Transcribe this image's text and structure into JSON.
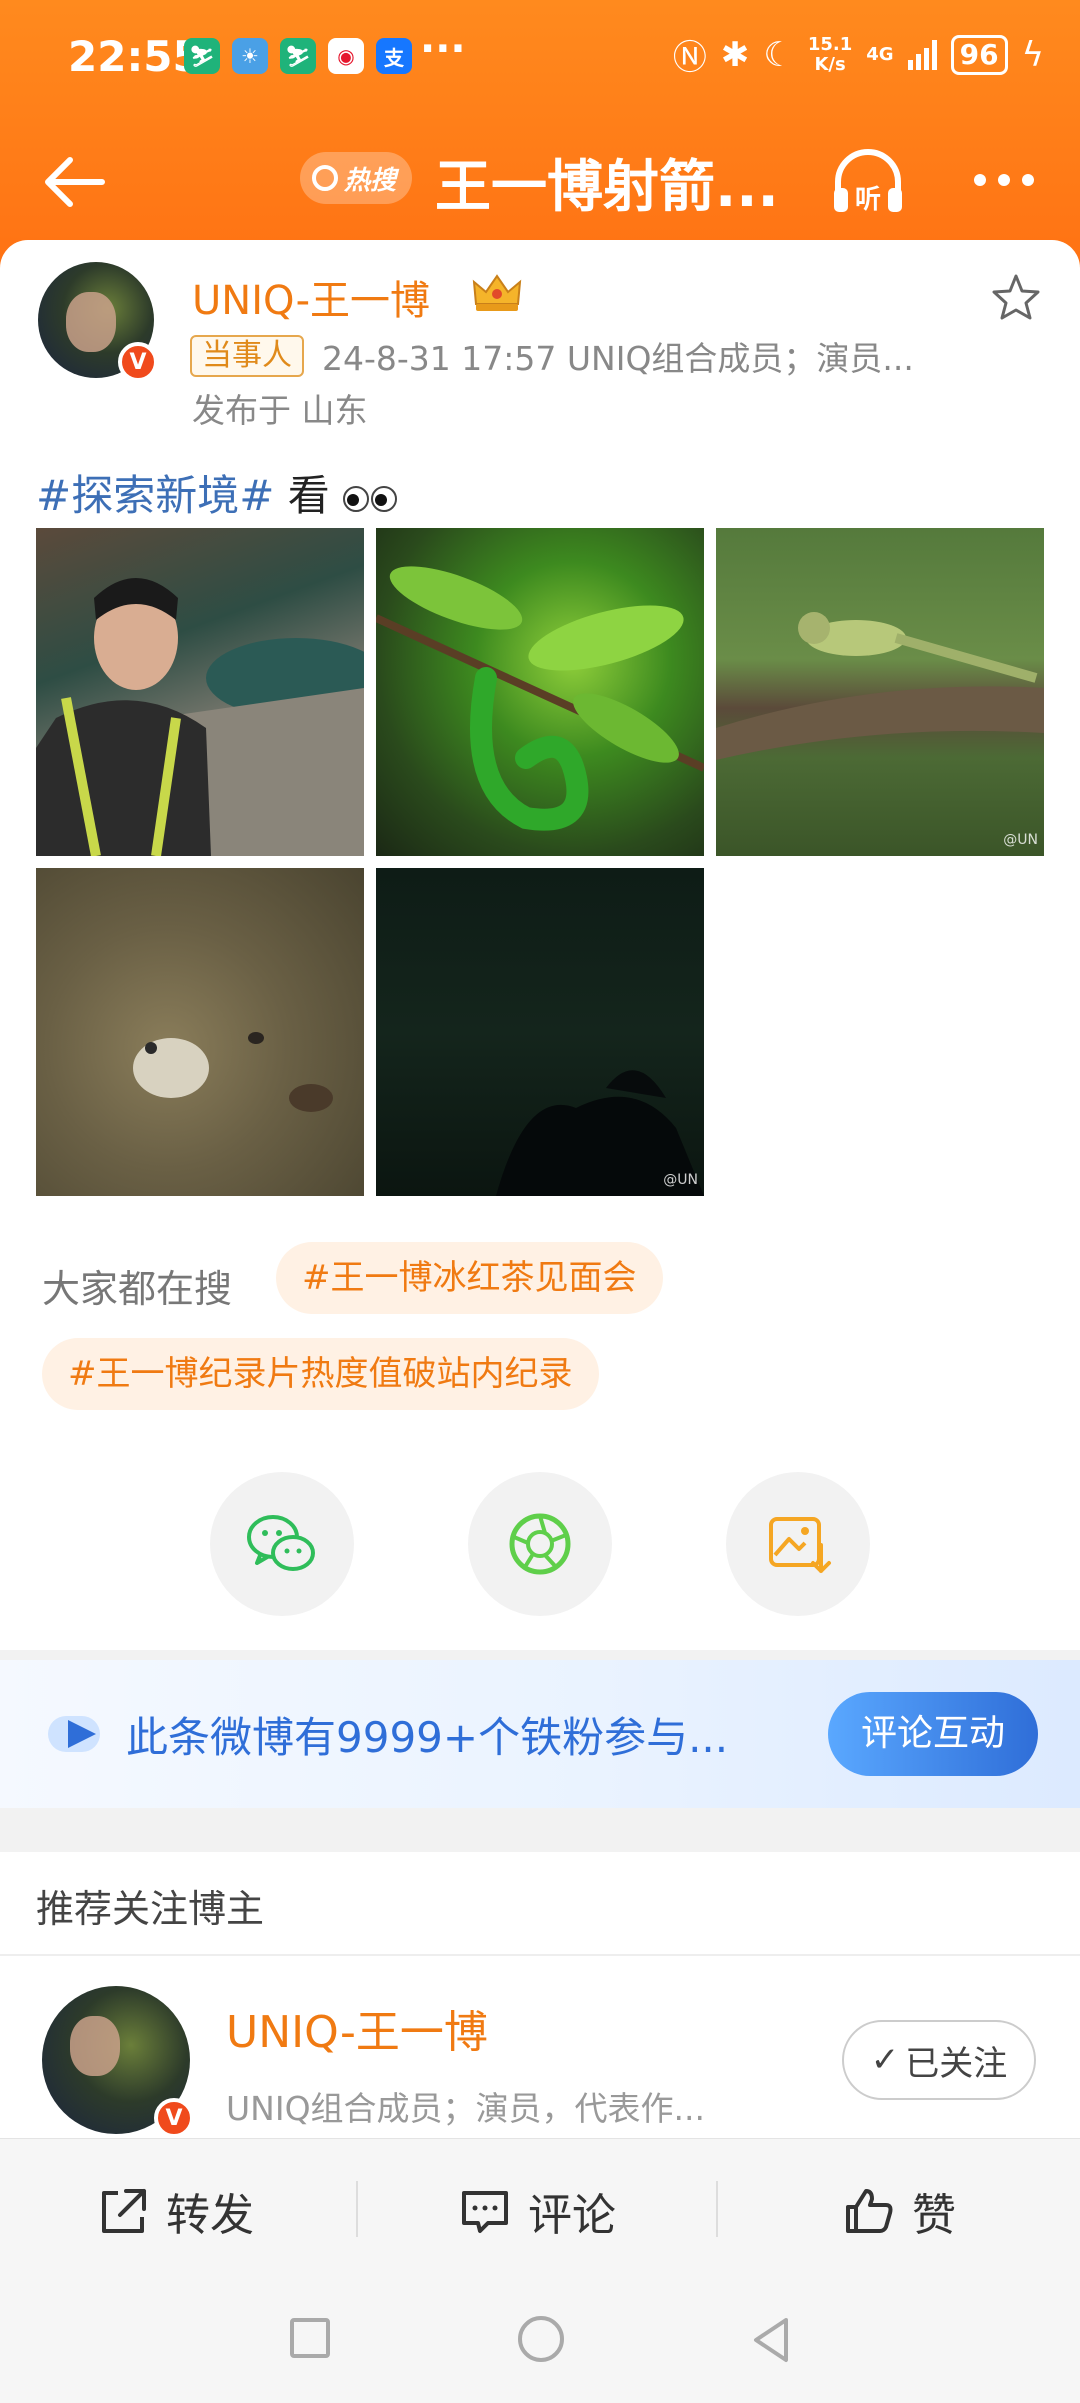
{
  "status_bar": {
    "time": "22:55",
    "net_speed_top": "15.1",
    "net_speed_bottom": "K/s",
    "network": "4G",
    "battery": "96"
  },
  "nav": {
    "hot_badge": "热搜",
    "title": "王一博射箭..."
  },
  "post": {
    "author": "UNIQ-王一博",
    "tag": "当事人",
    "meta": "24-8-31 17:57 UNIQ组合成员；演员...",
    "location": "发布于 山东",
    "topic": "#探索新境#",
    "text": " 看"
  },
  "photos": {
    "watermark": "@UN"
  },
  "search": {
    "label": "大家都在搜",
    "items": [
      "#王一博冰红茶见面会",
      "#王一博纪录片热度值破站内纪录"
    ]
  },
  "fan_banner": {
    "text": "此条微博有9999+个铁粉参与...",
    "button": "评论互动"
  },
  "recommend": {
    "title": "推荐关注博主",
    "name": "UNIQ-王一博",
    "desc": "UNIQ组合成员；演员，代表作...",
    "followed": "已关注"
  },
  "actions": {
    "repost": "转发",
    "comment": "评论",
    "like": "赞"
  },
  "colors": {
    "brand_orange": "#ff7a12",
    "name_orange": "#f07a12",
    "link_blue": "#2f6ed8"
  }
}
